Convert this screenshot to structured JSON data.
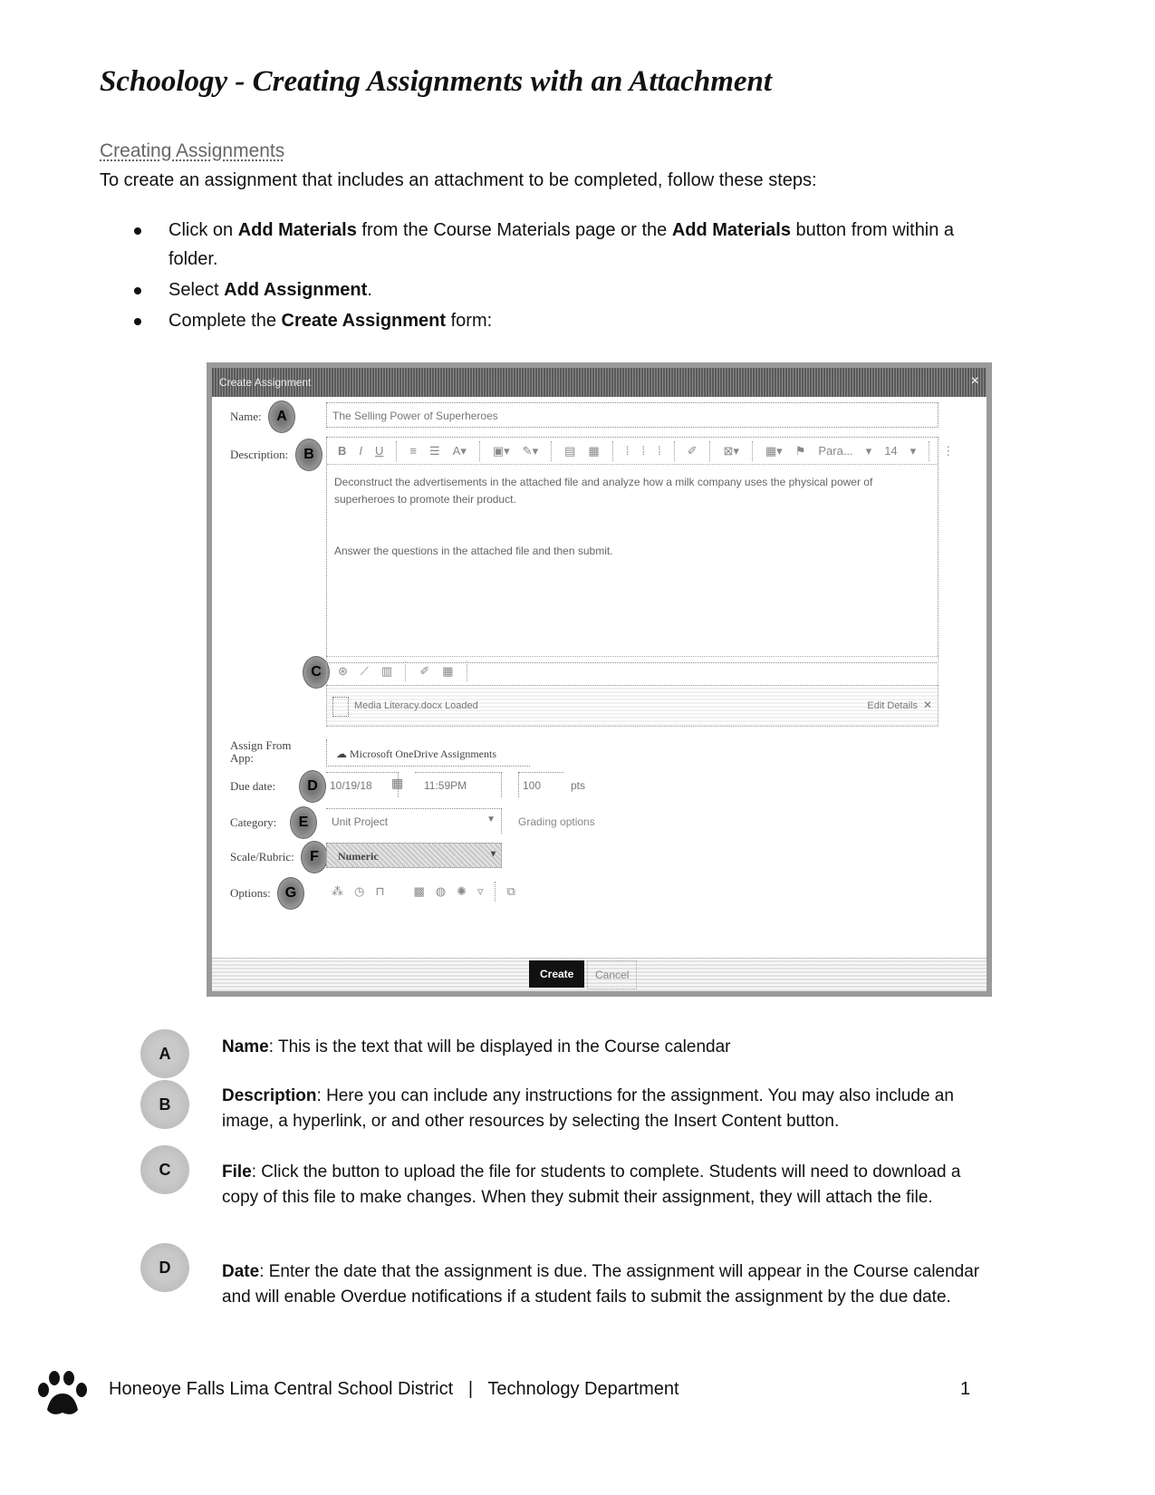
{
  "document": {
    "title": "Schoology - Creating Assignments with an Attachment",
    "section_heading": "Creating Assignments",
    "intro": "To create an assignment that includes an attachment to be completed, follow these steps:",
    "bullets": [
      {
        "parts": [
          "Click on ",
          "Add Materials",
          " from the Course Materials page or the ",
          "Add Materials",
          " button from within a folder."
        ]
      },
      {
        "parts": [
          "Select ",
          "Add Assignment",
          "."
        ]
      },
      {
        "parts": [
          "Complete the ",
          "Create Assignment",
          " form:"
        ]
      }
    ]
  },
  "dialog": {
    "title": "Create Assignment",
    "close_icon": "close-icon",
    "name_label": "Name:",
    "name_value": "The Selling Power of Superheroes",
    "description_label": "Description:",
    "toolbar_items": [
      "bold",
      "italic",
      "underline",
      "list-numbered",
      "list-bulleted",
      "font-color",
      "insert-image",
      "highlight",
      "align-left",
      "align-center",
      "align-right",
      "justify",
      "outdent",
      "pencil",
      "insert-content",
      "table",
      "format-painter",
      "paragraph-format",
      "font-size",
      "more"
    ],
    "format_select": "Para...",
    "font_size": "14",
    "description_paragraphs": [
      "Deconstruct the advertisements in the attached file and analyze how a milk company uses the physical power of superheroes to promote their product.",
      "Answer the questions in the attached file and then submit."
    ],
    "attach_toolbar": [
      "upload-file-icon",
      "link-icon",
      "resource-icon",
      "edit-icon",
      "table-icon"
    ],
    "attached_file": "Media Literacy.docx  Loaded",
    "attached_file_action": "Edit Details",
    "assign_from_app_label": "Assign From App:",
    "assign_from_app_value": "Microsoft OneDrive Assignments",
    "due_date_label": "Due date:",
    "due_date": "10/19/18",
    "due_time": "11:59PM",
    "points": "100",
    "points_unit": "pts",
    "category_label": "Category:",
    "category_value": "Unit Project",
    "grading_options": "Grading options",
    "scale_label": "Scale/Rubric:",
    "scale_value": "Numeric",
    "options_label": "Options:",
    "option_icons": [
      "hierarchy-icon",
      "clock-icon",
      "lock-icon",
      "grade-icon",
      "globe-icon",
      "settings-icon",
      "comment-icon",
      "copy-icon"
    ],
    "create_label": "Create",
    "cancel_label": "Cancel",
    "badges": [
      "A",
      "B",
      "C",
      "D",
      "E",
      "F",
      "G"
    ]
  },
  "legend": [
    {
      "letter": "A",
      "term": "Name",
      "text": ":  This is the text that will be displayed in the Course calendar"
    },
    {
      "letter": "B",
      "term": "Description",
      "text": ": Here you can include any instructions for the assignment.  You may also include an image, a hyperlink, or and other resources by selecting the Insert Content button."
    },
    {
      "letter": "C",
      "term": "File",
      "text": ": Click the button to upload the file for students to complete.  Students will need to download a copy of this file to make changes.  When they submit their assignment, they will attach the file."
    },
    {
      "letter": "D",
      "term": "Date",
      "text": ": Enter the date that the assignment is due.  The assignment will appear in the Course calendar and will enable Overdue notifications if a student fails to submit the assignment by the due date."
    }
  ],
  "footer": {
    "text": "Honeoye Falls Lima Central School District   |   Technology Department",
    "page_number": "1",
    "logo_icon": "paw-print-icon"
  }
}
